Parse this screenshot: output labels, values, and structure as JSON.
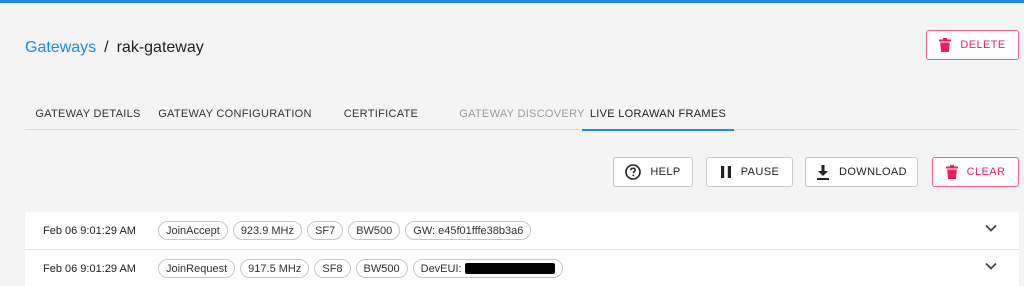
{
  "colors": {
    "accent": "#1e88e5",
    "danger": "#e91e63"
  },
  "breadcrumb": {
    "parent": "Gateways",
    "separator": "/",
    "current": "rak-gateway"
  },
  "header": {
    "delete_label": "DELETE",
    "delete_icon": "trash-icon"
  },
  "tabs": [
    {
      "label": "GATEWAY DETAILS",
      "state": "normal"
    },
    {
      "label": "GATEWAY CONFIGURATION",
      "state": "normal"
    },
    {
      "label": "CERTIFICATE",
      "state": "normal"
    },
    {
      "label": "GATEWAY DISCOVERY",
      "state": "disabled"
    },
    {
      "label": "LIVE LORAWAN FRAMES",
      "state": "active"
    }
  ],
  "toolbar": {
    "help_label": "HELP",
    "help_icon": "help-circle-icon",
    "pause_label": "PAUSE",
    "pause_icon": "pause-icon",
    "download_label": "DOWNLOAD",
    "download_icon": "download-icon",
    "clear_label": "CLEAR",
    "clear_icon": "trash-icon"
  },
  "frames": [
    {
      "time": "Feb 06 9:01:29 AM",
      "tags": [
        "JoinAccept",
        "923.9 MHz",
        "SF7",
        "BW500",
        "GW: e45f01fffe38b3a6"
      ]
    },
    {
      "time": "Feb 06 9:01:29 AM",
      "tags": [
        "JoinRequest",
        "917.5 MHz",
        "SF8",
        "BW500",
        "DevEUI:"
      ],
      "redacted": true
    }
  ]
}
